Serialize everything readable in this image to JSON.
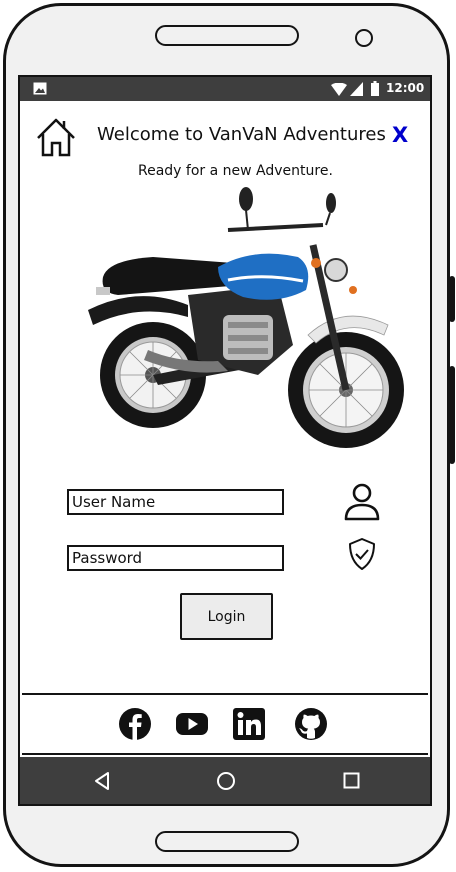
{
  "status_bar": {
    "time": "12:00",
    "icons": [
      "image-icon",
      "wifi-icon",
      "signal-icon",
      "battery-icon"
    ]
  },
  "header": {
    "home_icon": "home-icon",
    "title": "Welcome to VanVaN Adventures",
    "close_label": "X",
    "close_color": "#0000cc"
  },
  "subtitle": "Ready for a new Adventure.",
  "hero_image": {
    "subject": "motorcycle",
    "colors": [
      "#1f6fc4",
      "#111111",
      "#d8d8d8"
    ]
  },
  "form": {
    "username_placeholder": "User Name",
    "password_placeholder": "Password",
    "username_icon": "user-icon",
    "password_icon": "shield-check-icon",
    "login_label": "Login"
  },
  "social": {
    "icons": [
      "facebook-icon",
      "youtube-icon",
      "linkedin-icon",
      "github-icon"
    ]
  },
  "nav_bar": {
    "icons": [
      "back-icon",
      "home-circle-icon",
      "recents-icon"
    ]
  }
}
